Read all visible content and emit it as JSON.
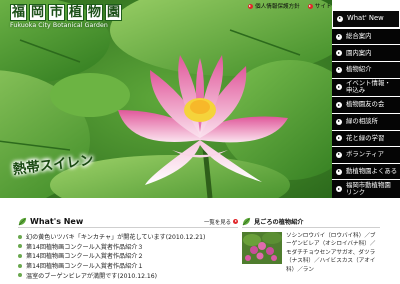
{
  "header": {
    "logo_chars": [
      "福",
      "岡",
      "市",
      "植",
      "物",
      "園"
    ],
    "logo_subtitle": "Fukuoka City Botanical Garden",
    "top_links": [
      "個人情報保護方針",
      "サイトマップ"
    ]
  },
  "hero": {
    "caption": "熱帯スイレン"
  },
  "nav": {
    "items": [
      {
        "label": "What' New"
      },
      {
        "label": "総合案内"
      },
      {
        "label": "園内案内"
      },
      {
        "label": "植物紹介"
      },
      {
        "label": "イベント情報・\n申込み"
      },
      {
        "label": "植物園友の会"
      },
      {
        "label": "緑の相談所"
      },
      {
        "label": "花と緑の学習"
      },
      {
        "label": "ボランティア"
      },
      {
        "label": "動植物園よくある"
      },
      {
        "label": "福岡市動植物園\nリンク"
      }
    ]
  },
  "news": {
    "title": "What's New",
    "more_label": "一覧を見る",
    "items": [
      "幻の黄色いツバキ「キンカチャ」が開花しています(2010.12.21)",
      "第14回植物画コンクール入賞者作品紹介３",
      "第14回植物画コンクール入賞者作品紹介２",
      "第14回植物画コンクール入賞者作品紹介１",
      "温室のブーゲンビレアが満開です(2010.12.16)"
    ]
  },
  "seasonal": {
    "title": "見ごろの植物紹介",
    "text": "ソシンロウバイ（ロウバイ科）／ブーゲンビレア（オシロイバナ科）／モダチチョウセンアサガオ、ダツラ（ナス科）／ハイビスカス（アオイ科）／ラン"
  },
  "colors": {
    "nav_bg": "#050505",
    "nav_text": "#ffffff",
    "accent_red": "#e0262a",
    "leaf_green": "#3f8e2a"
  }
}
